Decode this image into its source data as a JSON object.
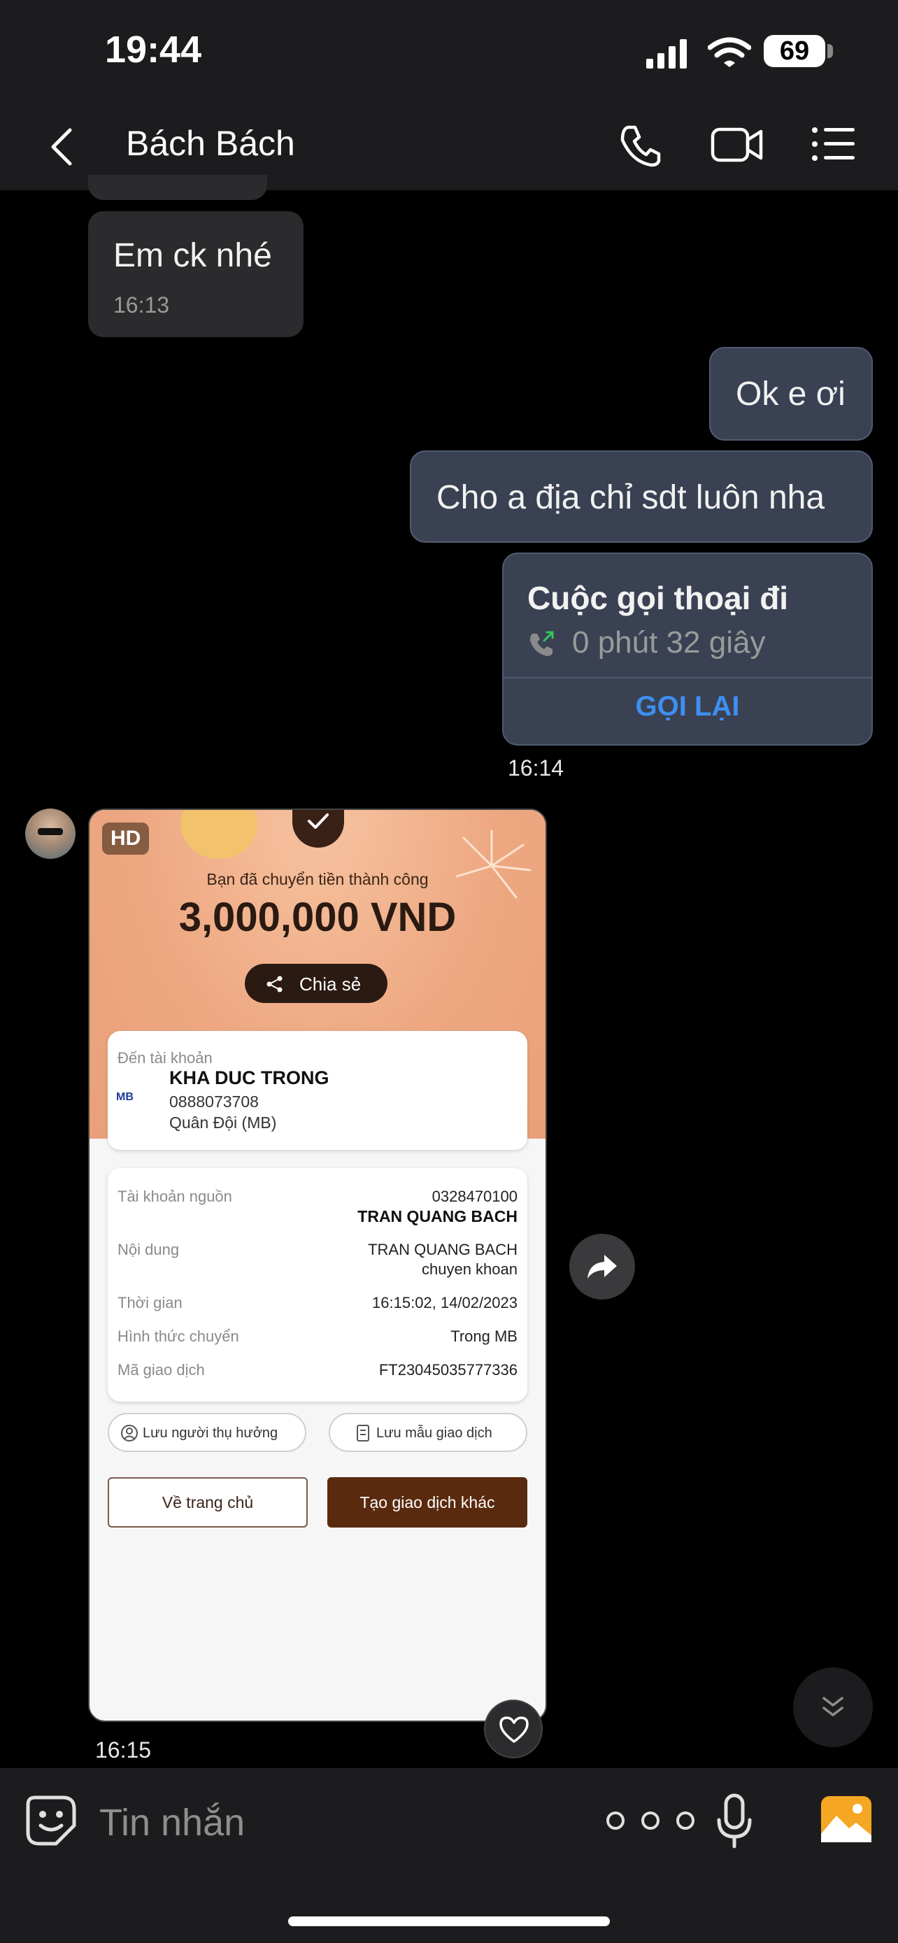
{
  "status_bar": {
    "time": "19:44",
    "battery": "69"
  },
  "header": {
    "contact_name": "Bách Bách"
  },
  "messages": [
    {
      "text": "Em ck nhé",
      "time": "16:13"
    },
    {
      "text": "Ok e ơi"
    },
    {
      "text": "Cho a địa chỉ sdt luôn nha"
    }
  ],
  "call_card": {
    "title": "Cuộc gọi thoại đi",
    "duration": "0 phút 32 giây",
    "action": "GỌI LẠI",
    "time": "16:14"
  },
  "image_message": {
    "badge": "HD",
    "time": "16:15",
    "receipt": {
      "success_text": "Bạn đã chuyển tiền thành công",
      "amount": "3,000,000 VND",
      "share_label": "Chia sẻ",
      "to_account_label": "Đến tài khoản",
      "recipient_name": "KHA DUC TRONG",
      "recipient_account": "0888073708",
      "recipient_bank": "Quân Đội (MB)",
      "bank_logo": "MB",
      "details": [
        {
          "label": "Tài khoản nguồn",
          "value": "0328470100",
          "value2": "TRAN QUANG BACH"
        },
        {
          "label": "Nội dung",
          "value": "TRAN QUANG BACH",
          "value2": "chuyen khoan"
        },
        {
          "label": "Thời gian",
          "value": "16:15:02, 14/02/2023"
        },
        {
          "label": "Hình thức chuyển",
          "value": "Trong MB"
        },
        {
          "label": "Mã giao dịch",
          "value": "FT23045035777336"
        }
      ],
      "save_beneficiary": "Lưu người thụ hưởng",
      "save_template": "Lưu mẫu giao dịch",
      "home_button": "Về trang chủ",
      "new_transaction_button": "Tạo giao dịch khác"
    }
  },
  "input_bar": {
    "placeholder": "Tin nhắn"
  },
  "colors": {
    "accent_blue": "#3d8ff0",
    "outgoing_bubble": "#3a4152",
    "incoming_bubble": "#2b2b2d",
    "receipt_brown": "#5a2a0e"
  }
}
